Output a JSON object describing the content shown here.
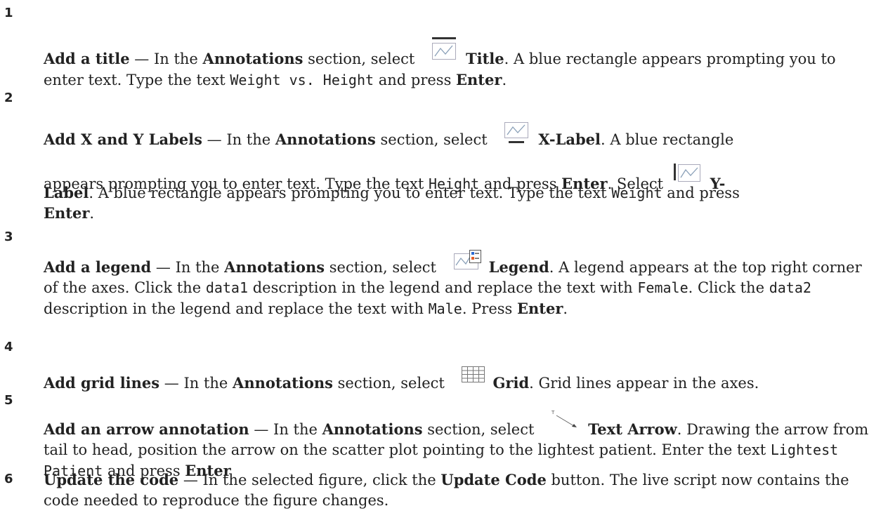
{
  "steps": [
    {
      "number": "1",
      "lead": "Add a title",
      "p1": " — In the ",
      "annotations": "Annotations",
      "p2": " section, select ",
      "icon": "title-icon",
      "button": "Title",
      "p3": ". A blue rectangle appears prompting you to enter text. Type the text ",
      "code": "Weight vs. Height",
      "p4": " and press ",
      "key": "Enter",
      "p5": "."
    },
    {
      "number": "2",
      "lead": "Add X and Y Labels",
      "p1": " — In the ",
      "annotations": "Annotations",
      "p2": " section, select ",
      "icon_x": "xlabel-icon",
      "button_x": "X-Label",
      "p3": ". A blue rectangle",
      "p4": "appears prompting you to enter text. Type the text ",
      "code_x": "Height",
      "p5": " and press ",
      "key1": "Enter",
      "p6": ". Select ",
      "icon_y": "ylabel-icon",
      "button_y_a": "Y-",
      "button_y_b": "Label",
      "p7": ". A blue rectangle appears prompting you to enter text. Type the text ",
      "code_y": "Weight",
      "p8": " and press",
      "key2": "Enter",
      "p9": "."
    },
    {
      "number": "3",
      "lead": "Add a legend",
      "p1": " — In the ",
      "annotations": "Annotations",
      "p2": " section, select ",
      "icon": "legend-icon",
      "button": "Legend",
      "p3": ". A legend appears at the top right corner of the axes. Click the ",
      "code1": "data1",
      "p4": " description in the legend and replace the text with ",
      "code2": "Female",
      "p5": ". Click the ",
      "code3": "data2",
      "p6": " description in the legend and replace the text with ",
      "code4": "Male",
      "p7": ". Press ",
      "key": "Enter",
      "p8": "."
    },
    {
      "number": "4",
      "lead": "Add grid lines",
      "p1": " — In the ",
      "annotations": "Annotations",
      "p2": " section, select ",
      "icon": "grid-icon",
      "button": "Grid",
      "p3": ". Grid lines appear in the axes."
    },
    {
      "number": "5",
      "lead": "Add an arrow annotation",
      "p1": " — In the ",
      "annotations": "Annotations",
      "p2": " section, select ",
      "icon": "text-arrow-icon",
      "button": "Text Arrow",
      "p3": ". Drawing the arrow from tail to head, position the arrow on the scatter plot pointing to the lightest patient. Enter the text ",
      "code": "Lightest Patient",
      "p4": " and press ",
      "key": "Enter"
    },
    {
      "number": "6",
      "lead": "Update the code",
      "p1": " — In the selected figure, click the ",
      "button": "Update Code",
      "p2": " button. The live script now contains the code needed to reproduce the figure changes."
    }
  ]
}
